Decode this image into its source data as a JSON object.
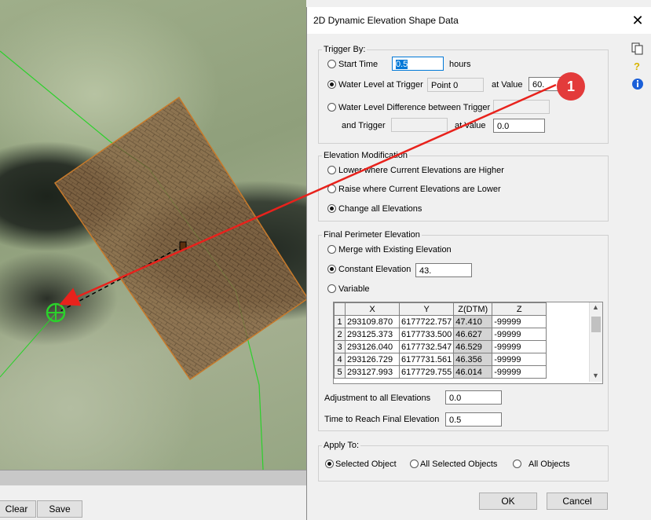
{
  "bottom_bar": {
    "clear_label": "Clear",
    "save_label": "Save"
  },
  "dialog": {
    "title": "2D Dynamic Elevation Shape Data",
    "trigger": {
      "legend": "Trigger By:",
      "start_time_label": "Start Time",
      "start_time_value": "0.5",
      "hours_label": "hours",
      "water_level_label": "Water Level at Trigger",
      "trigger_point": "Point 0",
      "at_value_label": "at Value",
      "water_level_value": "60.",
      "diff_label": "Water Level Difference between Trigger",
      "and_trigger_label": "and Trigger",
      "diff_at_value_label": "at Value",
      "diff_value": "0.0",
      "selected": "water_level"
    },
    "elevation_mod": {
      "legend": "Elevation Modification",
      "options": [
        "Lower where Current Elevations are Higher",
        "Raise where Current Elevations are Lower",
        "Change all Elevations"
      ],
      "selected_index": 2
    },
    "final_perimeter": {
      "legend": "Final Perimeter Elevation",
      "merge_label": "Merge with Existing Elevation",
      "constant_label": "Constant Elevation",
      "constant_value": "43.",
      "variable_label": "Variable",
      "selected": "constant",
      "table": {
        "headers": [
          "X",
          "Y",
          "Z(DTM)",
          "Z"
        ],
        "rows": [
          [
            "1",
            "293109.870",
            "6177722.757",
            "47.410",
            "-99999"
          ],
          [
            "2",
            "293125.373",
            "6177733.500",
            "46.627",
            "-99999"
          ],
          [
            "3",
            "293126.040",
            "6177732.547",
            "46.529",
            "-99999"
          ],
          [
            "4",
            "293126.729",
            "6177731.561",
            "46.356",
            "-99999"
          ],
          [
            "5",
            "293127.993",
            "6177729.755",
            "46.014",
            "-99999"
          ]
        ]
      },
      "adjustment_label": "Adjustment to all Elevations",
      "adjustment_value": "0.0",
      "time_label": "Time to Reach Final Elevation",
      "time_value": "0.5"
    },
    "apply_to": {
      "legend": "Apply To:",
      "options": [
        "Selected Object",
        "All Selected Objects",
        "All Objects"
      ],
      "selected_index": 0
    },
    "ok_label": "OK",
    "cancel_label": "Cancel"
  },
  "annotation": {
    "badge": "1",
    "badge_color": "#e33b3b",
    "arrow_color": "#e8221c"
  },
  "icons": [
    "copy-icon",
    "help-icon",
    "info-icon",
    "close-icon"
  ]
}
